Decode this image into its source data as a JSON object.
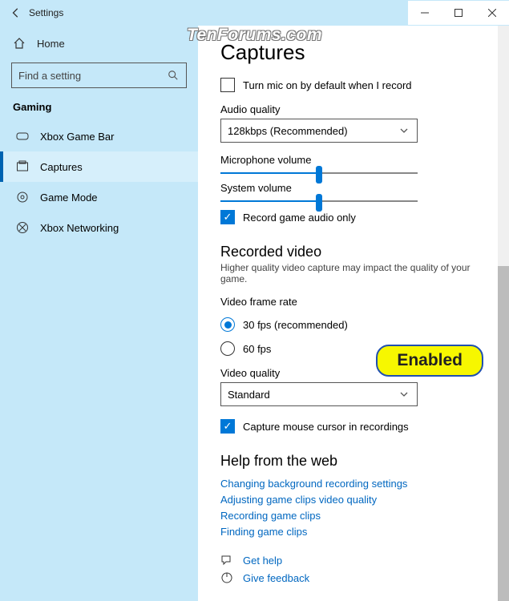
{
  "titlebar": {
    "title": "Settings"
  },
  "sidebar": {
    "home": "Home",
    "search_placeholder": "Find a setting",
    "category": "Gaming",
    "items": [
      {
        "label": "Xbox Game Bar"
      },
      {
        "label": "Captures"
      },
      {
        "label": "Game Mode"
      },
      {
        "label": "Xbox Networking"
      }
    ]
  },
  "content": {
    "heading": "Captures",
    "mic_checkbox": "Turn mic on by default when I record",
    "audio_quality_label": "Audio quality",
    "audio_quality_value": "128kbps (Recommended)",
    "mic_volume_label": "Microphone volume",
    "mic_volume": 50,
    "sys_volume_label": "System volume",
    "sys_volume": 50,
    "record_game_audio": "Record game audio only",
    "recorded_video_heading": "Recorded video",
    "recorded_video_sub": "Higher quality video capture may impact the quality of your game.",
    "frame_rate_label": "Video frame rate",
    "fps_30": "30 fps (recommended)",
    "fps_60": "60 fps",
    "video_quality_label": "Video quality",
    "video_quality_value": "Standard",
    "capture_cursor": "Capture mouse cursor in recordings",
    "help_heading": "Help from the web",
    "help_links": [
      "Changing background recording settings",
      "Adjusting game clips video quality",
      "Recording game clips",
      "Finding game clips"
    ],
    "get_help": "Get help",
    "give_feedback": "Give feedback"
  },
  "watermark": "TenForums.com",
  "badge": "Enabled"
}
